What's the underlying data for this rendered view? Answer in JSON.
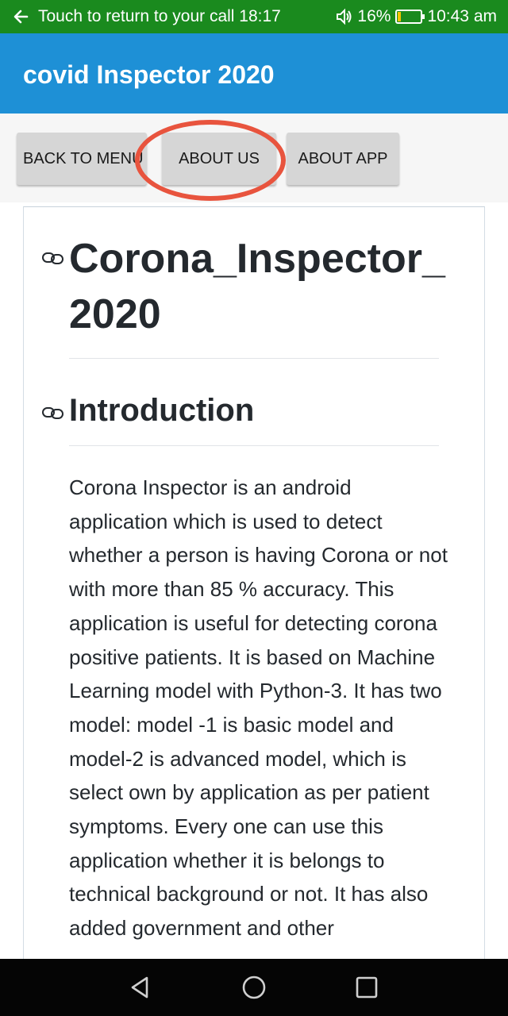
{
  "status_bar": {
    "call_text": "Touch to return to your call 18:17",
    "battery_percent": "16%",
    "battery_level": 0.16,
    "time": "10:43 am"
  },
  "app_bar": {
    "title": "covid Inspector 2020"
  },
  "nav_buttons": {
    "back_to_menu": "BACK TO MENU",
    "about_us": "ABOUT US",
    "about_app": "ABOUT APP"
  },
  "content": {
    "heading1": "Corona_Inspector_2020",
    "heading2": "Introduction",
    "paragraph": "Corona Inspector is an android application which is used to detect whether a person is having Corona or not with more than 85 % accuracy. This application is useful for detecting corona positive patients. It is based on Machine Learning model with Python-3. It has two model: model -1 is basic model and model-2 is advanced model, which is select own by application as per patient symptoms. Every one can use this application whether it is belongs to technical background or not. It has also added government and other"
  },
  "colors": {
    "status_bar": "#1a8a1e",
    "app_bar": "#1e90d6",
    "highlight": "#e8543e"
  },
  "icons": [
    "back-arrow-icon",
    "volume-icon",
    "battery-icon",
    "link-icon",
    "nav-back-icon",
    "nav-home-icon",
    "nav-recents-icon"
  ]
}
